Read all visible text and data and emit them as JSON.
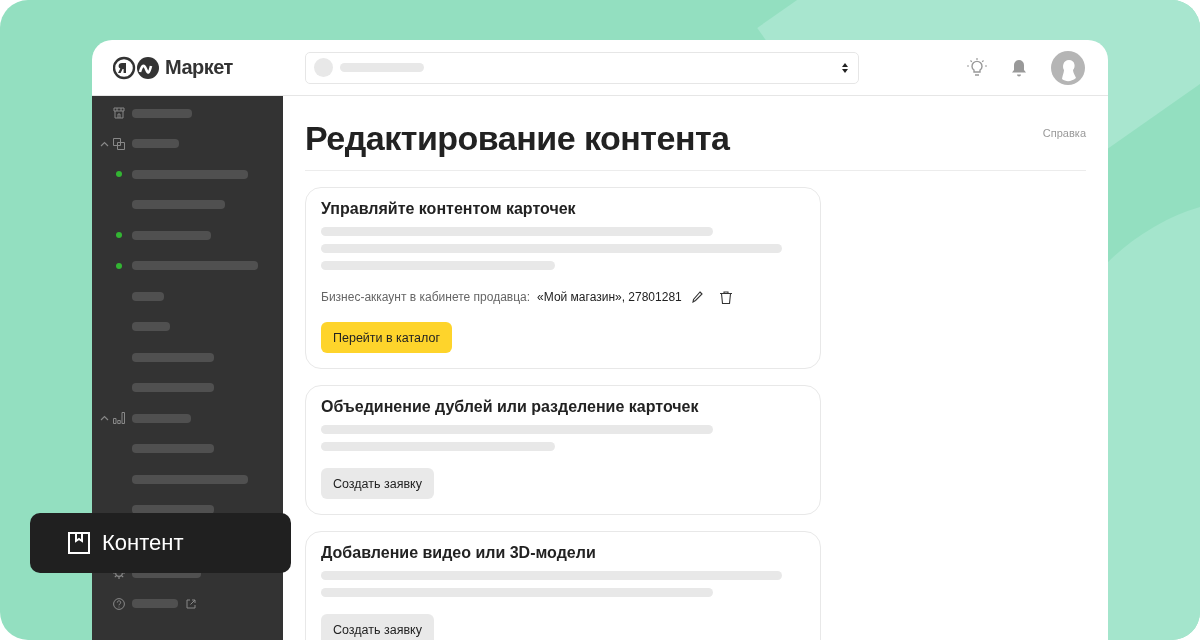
{
  "header": {
    "logo": "Маркет"
  },
  "sidebar": {
    "items": [
      {
        "kind": "link"
      },
      {
        "kind": "section",
        "expanded": true
      },
      {
        "kind": "item",
        "dot": true
      },
      {
        "kind": "item",
        "dot": false
      },
      {
        "kind": "item",
        "dot": true
      },
      {
        "kind": "item",
        "dot": true
      },
      {
        "kind": "item",
        "dot": false
      },
      {
        "kind": "item",
        "dot": false
      },
      {
        "kind": "item",
        "dot": false
      },
      {
        "kind": "item",
        "dot": false
      },
      {
        "kind": "section",
        "expanded": true
      },
      {
        "kind": "item",
        "dot": false
      },
      {
        "kind": "item",
        "dot": false
      },
      {
        "kind": "item",
        "dot": false
      },
      {
        "kind": "spacer"
      },
      {
        "kind": "link"
      },
      {
        "kind": "link",
        "external": true
      }
    ]
  },
  "tooltip": {
    "label": "Контент"
  },
  "page": {
    "title": "Редактирование контента",
    "help_link": "Справка"
  },
  "cards": [
    {
      "title": "Управляйте контентом карточек",
      "account": {
        "label": "Бизнес-аккаунт в кабинете продавца:",
        "value": "«Мой магазин», 27801281"
      },
      "button": {
        "label": "Перейти в каталог",
        "kind": "primary"
      }
    },
    {
      "title": "Объединение дублей или разделение карточек",
      "button": {
        "label": "Создать заявку",
        "kind": "secondary"
      }
    },
    {
      "title": "Добавление видео или 3D-модели",
      "button": {
        "label": "Создать заявку",
        "kind": "secondary"
      }
    }
  ]
}
